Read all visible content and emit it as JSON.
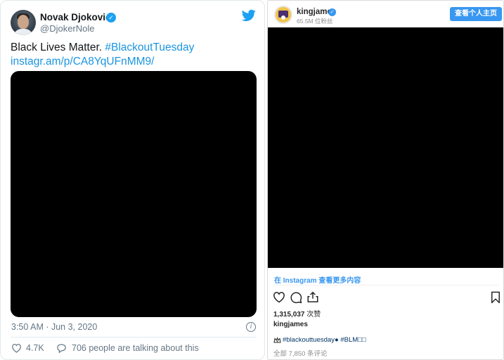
{
  "twitter": {
    "author_name": "Novak Djokovic",
    "handle": "@DjokerNole",
    "text_main": "Black Lives Matter.",
    "hashtag": "#BlackoutTuesday",
    "link": "instagr.am/p/CA8YqUFnMM9/",
    "timestamp": "3:50 AM · Jun 3, 2020",
    "likes": "4.7K",
    "conversation": "706 people are talking about this",
    "colors": {
      "link": "#1b95e0",
      "verified": "#1da1f2",
      "muted": "#657786"
    },
    "icons": [
      "twitter-bird-icon",
      "verified-badge-icon",
      "info-icon",
      "heart-icon",
      "reply-icon"
    ]
  },
  "instagram": {
    "username": "kingjames",
    "followers": "65.5M 位粉丝",
    "profile_button": "查看个人主页",
    "view_more": "在 Instagram 查看更多内容",
    "likes_count": "1,315,037",
    "likes_suffix": " 次赞",
    "owner": "kingjames",
    "caption": "#blackouttuesday● #BLM□□",
    "comments": "全部 7,850 条评论",
    "colors": {
      "button": "#3897f0",
      "caption_link": "#003569",
      "muted": "#8e8e8e"
    },
    "icons": [
      "verified-badge-icon",
      "heart-outline-icon",
      "comment-icon",
      "share-icon",
      "bookmark-icon",
      "crown-emoji-icon"
    ]
  }
}
